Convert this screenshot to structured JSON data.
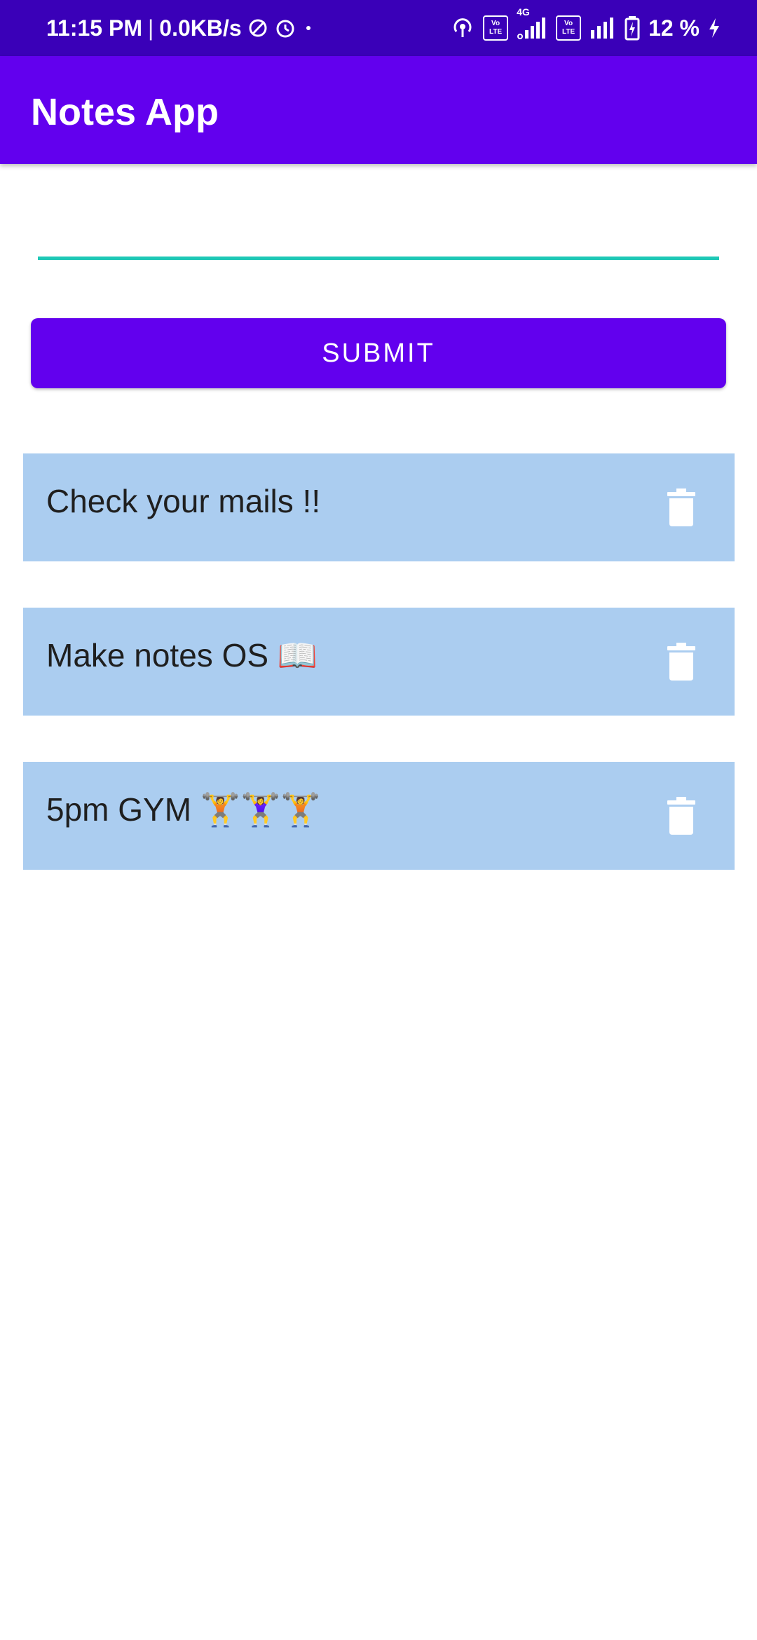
{
  "status_bar": {
    "time": "11:15 PM",
    "separator": "|",
    "network_speed": "0.0KB/s",
    "network_type": "4G",
    "volte_top": "Vo",
    "volte_bottom": "LTE",
    "battery": "12 %"
  },
  "app_bar": {
    "title": "Notes App"
  },
  "input": {
    "value": "",
    "placeholder": ""
  },
  "submit": {
    "label": "SUBMIT"
  },
  "notes": [
    {
      "text": "Check your mails !!"
    },
    {
      "text": "Make notes OS 📖"
    },
    {
      "text": "5pm GYM 🏋️🏋️‍♀️🏋️"
    }
  ],
  "colors": {
    "status_bar": "#3a00b8",
    "primary": "#6200ee",
    "accent": "#1fc8b6",
    "note_bg": "#abcdf0"
  },
  "icons": {
    "delete": "trash-icon"
  }
}
